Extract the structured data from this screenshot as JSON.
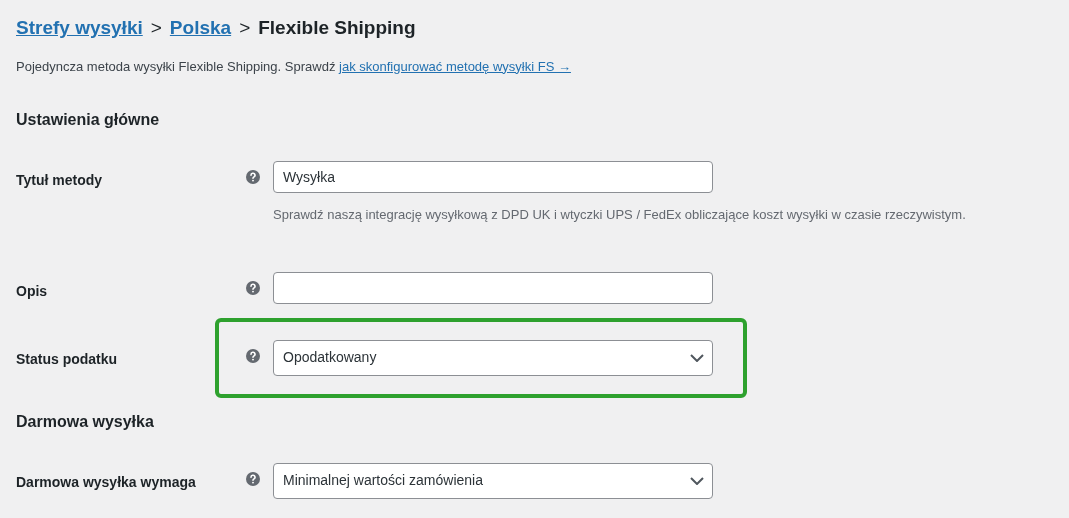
{
  "breadcrumb": [
    {
      "label": "Strefy wysyłki",
      "link": true
    },
    {
      "label": "Polska",
      "link": true
    },
    {
      "label": "Flexible Shipping",
      "link": false
    }
  ],
  "separator": ">",
  "intro": {
    "text": "Pojedyncza metoda wysyłki Flexible Shipping. Sprawdź",
    "link": "jak skonfigurować metodę wysyłki FS →"
  },
  "sections": [
    {
      "heading": "Ustawienia główne",
      "fields": [
        {
          "kind": "text",
          "label": "Tytuł metody",
          "value": "Wysyłka",
          "description": "Sprawdź naszą integrację wysyłkową z DPD UK i wtyczki UPS / FedEx obliczające koszt wysyłki w czasie rzeczywistym.",
          "highlighted": false
        },
        {
          "kind": "text",
          "label": "Opis",
          "highlighted": false
        },
        {
          "kind": "select",
          "label": "Status podatku",
          "value": "Opodatkowany",
          "highlighted": true
        }
      ]
    },
    {
      "heading": "Darmowa wysyłka",
      "fields": [
        {
          "kind": "select",
          "label": "Darmowa wysyłka wymaga",
          "value": "Minimalnej wartości zamówienia",
          "highlighted": false
        }
      ]
    }
  ]
}
